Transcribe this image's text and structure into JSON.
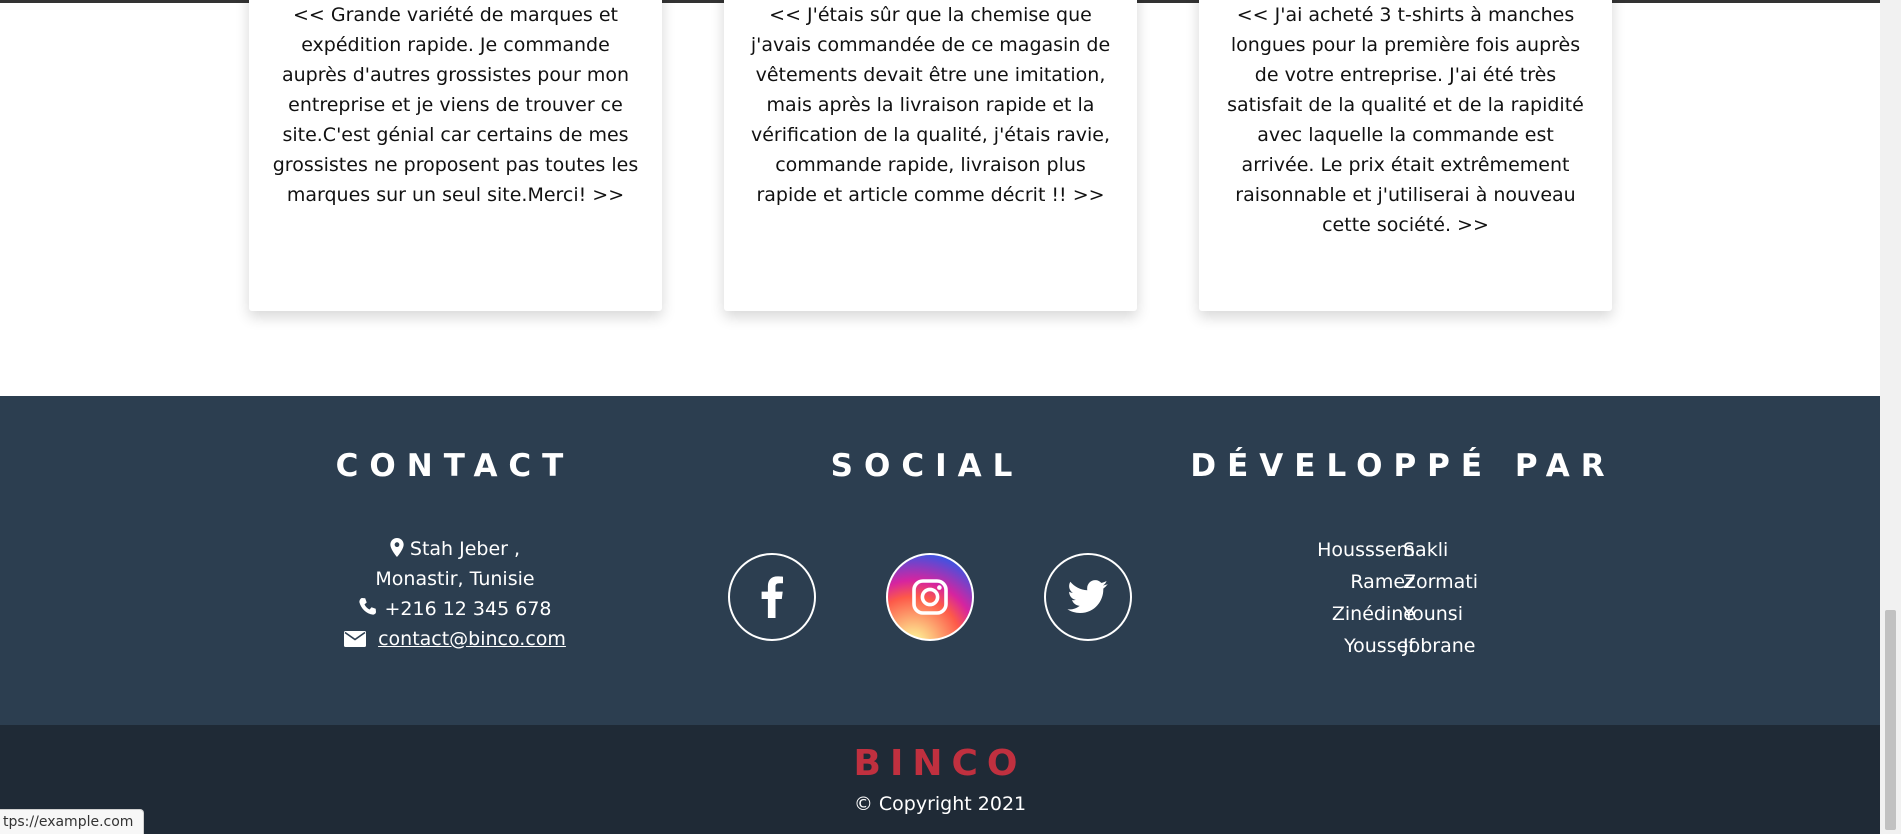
{
  "testimonials": [
    {
      "text": "<< Grande variété de marques et expédition rapide. Je commande auprès d'autres grossistes pour mon entreprise et je viens de trouver ce site.C'est génial car certains de mes grossistes ne proposent pas toutes les marques sur un seul site.Merci! >>"
    },
    {
      "text": "<< J'étais sûr que la chemise que j'avais commandée de ce magasin de vêtements devait être une imitation, mais après la livraison rapide et la vérification de la qualité, j'étais ravie, commande rapide, livraison plus rapide et article comme décrit !! >>"
    },
    {
      "text": "<< J'ai acheté 3 t-shirts à manches longues pour la première fois auprès de votre entreprise. J'ai été très satisfait de la qualité et de la rapidité avec laquelle la commande est arrivée. Le prix était extrêmement raisonnable et j'utiliserai à nouveau cette société. >>"
    }
  ],
  "footer": {
    "contact": {
      "title": "CONTACT",
      "address_line1": "Stah Jeber ,",
      "address_line2": "Monastir, Tunisie",
      "phone": "+216 12 345 678",
      "email": "contact@binco.com",
      "icons": [
        "map-marker-icon",
        "phone-icon",
        "envelope-icon"
      ]
    },
    "social": {
      "title": "SOCIAL",
      "networks": [
        "facebook-icon",
        "instagram-icon",
        "twitter-icon"
      ]
    },
    "developers": {
      "title": "DÉVELOPPÉ PAR",
      "people": [
        {
          "first": "Housssem",
          "last": "Sakli"
        },
        {
          "first": "Ramez",
          "last": "Zormati"
        },
        {
          "first": "Zinédine",
          "last": "Younsi"
        },
        {
          "first": "Youssef",
          "last": "Jobrane"
        }
      ]
    },
    "bottom": {
      "brand": "BINCO",
      "copyright": "© Copyright 2021",
      "brand_color": "#c0303f"
    }
  },
  "status_bar": {
    "url": "tps://example.com"
  },
  "colors": {
    "footer_bg": "#2c3e50",
    "footer_bottom_bg": "#1f2a36"
  }
}
